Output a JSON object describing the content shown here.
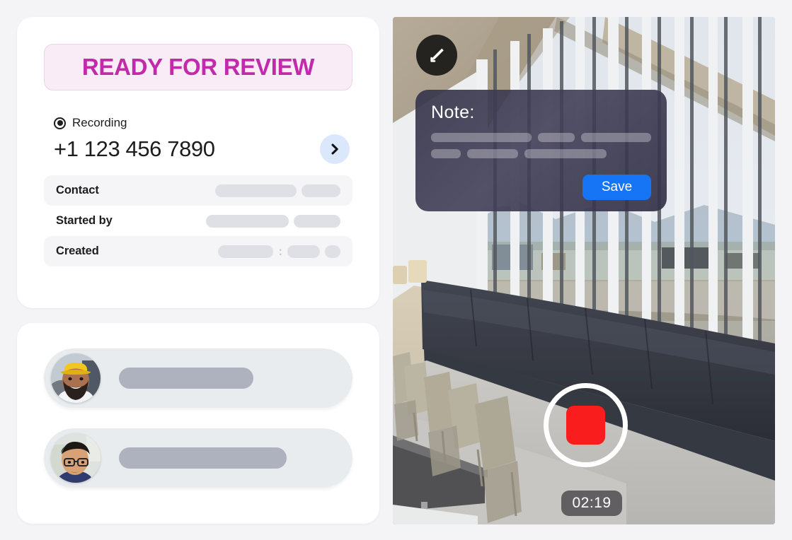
{
  "status": {
    "badge_label": "READY FOR REVIEW",
    "badge_text_color": "#c02aab",
    "badge_bg_color": "#f9ecf6",
    "badge_border_color": "#ecd3e6"
  },
  "recording": {
    "radio_label": "Recording",
    "radio_selected": true,
    "phone_number": "+1 123 456 7890",
    "chevron_icon": "chevron-right-icon",
    "chevron_bg_color": "#dbe7fb"
  },
  "details": {
    "rows": [
      {
        "label": "Contact",
        "shaded": true,
        "skeletons": [
          115,
          55
        ],
        "separator": null
      },
      {
        "label": "Started by",
        "shaded": false,
        "skeletons": [
          117,
          66
        ],
        "separator": null
      },
      {
        "label": "Created",
        "shaded": true,
        "skeletons": [
          78,
          46,
          22
        ],
        "separator": ":"
      }
    ]
  },
  "people": {
    "rows": [
      {
        "avatar": "avatar-bearded-worker-hardhat",
        "skeleton_width": 190
      },
      {
        "avatar": "avatar-man-glasses",
        "skeleton_width": 237
      }
    ]
  },
  "video": {
    "edit_icon": "pencil-edit-icon",
    "note": {
      "title": "Note:",
      "lines": [
        [
          168,
          62,
          117
        ],
        [
          42,
          72,
          116
        ]
      ],
      "save_label": "Save",
      "save_color": "#1675f5"
    },
    "record": {
      "icon": "stop-record-square-icon",
      "color": "#f91d1d",
      "ring_color": "#ffffff"
    },
    "timer": "02:19"
  }
}
